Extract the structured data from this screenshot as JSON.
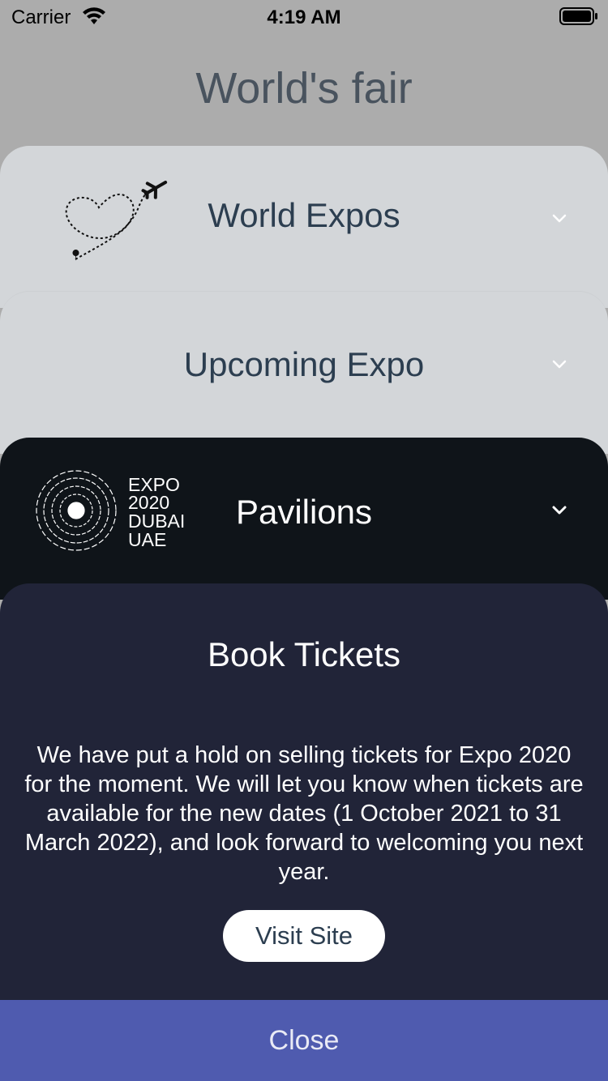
{
  "status_bar": {
    "carrier": "Carrier",
    "time": "4:19 AM",
    "wifi_icon": "wifi-icon",
    "battery_icon": "battery-icon"
  },
  "header": {
    "title": "World's fair"
  },
  "cards": {
    "world_expos": {
      "title": "World Expos",
      "icon": "heart-airplane-icon",
      "chevron_icon": "chevron-down-icon"
    },
    "upcoming_expo": {
      "title": "Upcoming Expo",
      "chevron_icon": "chevron-down-icon"
    },
    "pavilions": {
      "title": "Pavilions",
      "logo_lines": [
        "EXPO",
        "2020",
        "DUBAI",
        "UAE"
      ],
      "chevron_icon": "chevron-down-icon"
    },
    "book_tickets": {
      "title": "Book Tickets",
      "body": "We have put a hold on selling tickets for Expo 2020 for the moment. We will let you know when tickets are available for the new dates (1 October 2021 to 31 March 2022), and look forward to welcoming you next year.",
      "button_label": "Visit Site"
    }
  },
  "footer": {
    "close_label": "Close"
  },
  "colors": {
    "background": "#acacac",
    "light_card": "#d3d6d9",
    "dark_card": "#0f1419",
    "tickets_card": "#212438",
    "close_bar": "#4f5baf",
    "title_text": "#2c3e50"
  }
}
